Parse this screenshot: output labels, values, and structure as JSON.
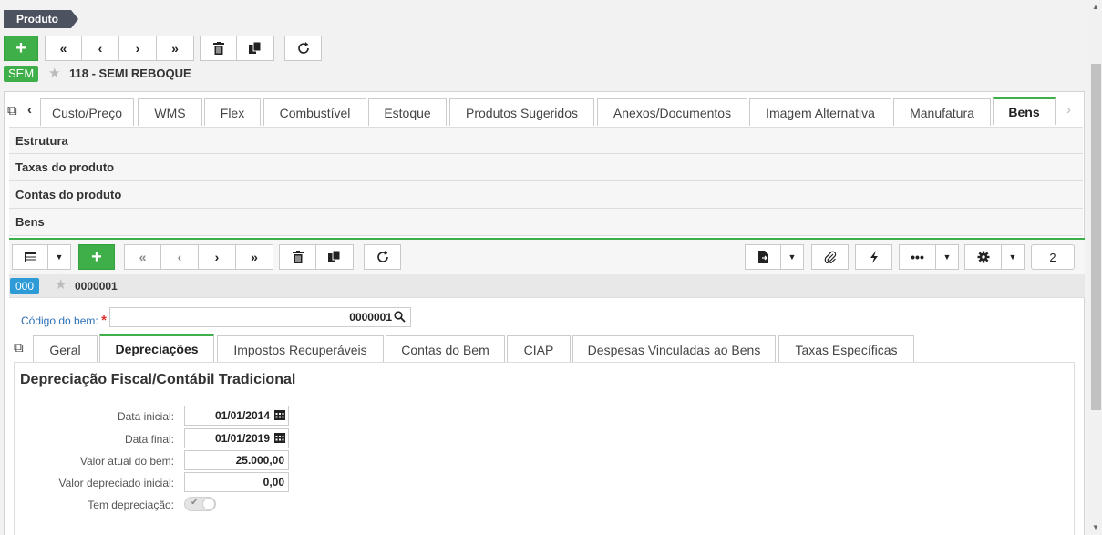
{
  "breadcrumb": "Produto",
  "record": {
    "badge": "SEM",
    "title": "118 - SEMI REBOQUE"
  },
  "tabs": [
    "Custo/Preço",
    "WMS",
    "Flex",
    "Combustível",
    "Estoque",
    "Produtos Sugeridos",
    "Anexos/Documentos",
    "Imagem Alternativa",
    "Manufatura",
    "Bens"
  ],
  "sections": [
    "Estrutura",
    "Taxas do produto",
    "Contas do produto",
    "Bens"
  ],
  "sub": {
    "count": "2",
    "badge": "000",
    "title": "0000001",
    "code_label": "Código do bem:",
    "code_required": "*",
    "code_value": "0000001"
  },
  "subtabs": [
    "Geral",
    "Depreciações",
    "Impostos Recuperáveis",
    "Contas do Bem",
    "CIAP",
    "Despesas Vinculadas ao Bens",
    "Taxas Específicas"
  ],
  "form": {
    "heading": "Depreciação Fiscal/Contábil Tradicional",
    "data_inicial_label": "Data inicial:",
    "data_inicial": "01/01/2014",
    "data_final_label": "Data final:",
    "data_final": "01/01/2019",
    "valor_atual_label": "Valor atual do bem:",
    "valor_atual": "25.000,00",
    "valor_depreciado_label": "Valor depreciado inicial:",
    "valor_depreciado": "0,00",
    "tem_depreciacao_label": "Tem depreciação:",
    "tem_depreciacao": "✔"
  },
  "colors": {
    "green": "#3fb049",
    "badge_green": "#3fb049",
    "badge_blue": "#2e9bd6",
    "label_blue": "#2c6fb6"
  }
}
